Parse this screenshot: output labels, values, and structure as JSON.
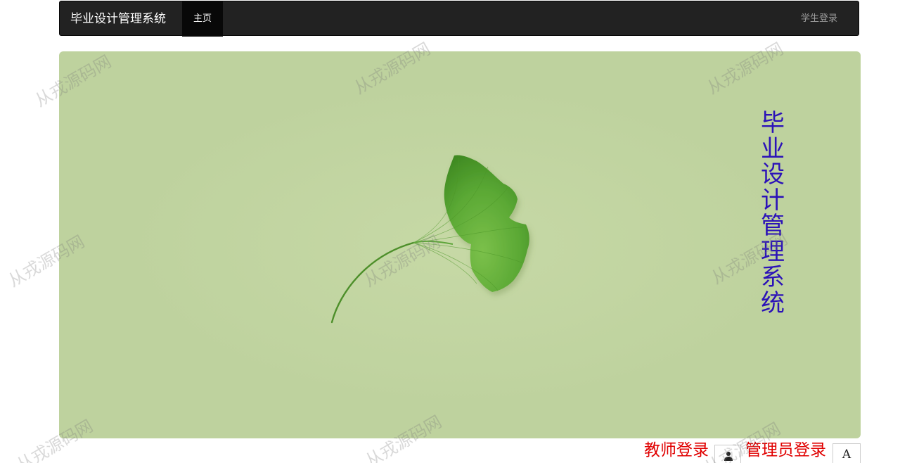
{
  "navbar": {
    "brand": "毕业设计管理系统",
    "home_label": "主页",
    "student_login_label": "学生登录"
  },
  "hero": {
    "vertical_title": "毕业设计管理系统",
    "background_color": "#bed29e",
    "title_color": "#2b12b8"
  },
  "login_bar": {
    "teacher_login_label": "教师登录",
    "teacher_icon": "person-icon",
    "admin_login_label": "管理员登录",
    "admin_icon": "letter-a-icon",
    "admin_icon_glyph": "A",
    "link_color": "#e00000"
  },
  "watermark": {
    "text": "从戎源码网"
  }
}
